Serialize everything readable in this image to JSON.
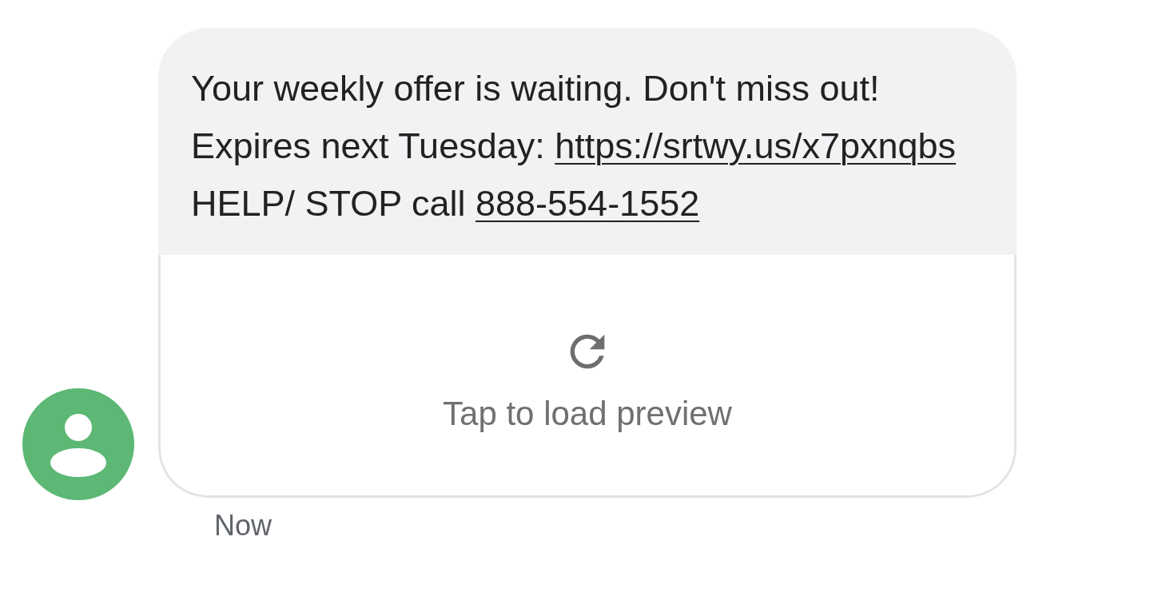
{
  "message": {
    "parts": [
      {
        "kind": "text",
        "text": "Your weekly offer is waiting. Don't miss out! Expires next Tuesday: "
      },
      {
        "kind": "link",
        "text": "https://srtwy.us/x7pxnqbs"
      },
      {
        "kind": "text",
        "text": "  HELP/ STOP call "
      },
      {
        "kind": "link",
        "text": "888-554-1552"
      }
    ],
    "preview": {
      "label": "Tap to load preview"
    },
    "time": "Now"
  }
}
